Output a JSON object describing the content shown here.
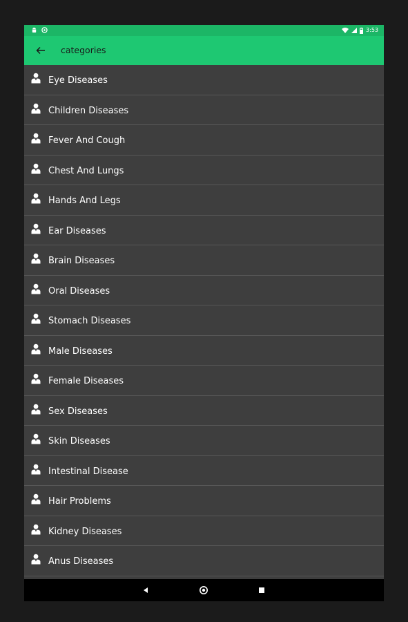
{
  "status_bar": {
    "time": "3:53",
    "background": "#1cb666"
  },
  "app_bar": {
    "title": "categories",
    "back_icon": "arrow-back-icon",
    "background": "#1ec872"
  },
  "list": {
    "item_icon": "person-icon",
    "background": "#3e3e3e",
    "items": [
      {
        "label": "Eye Diseases"
      },
      {
        "label": "Children Diseases"
      },
      {
        "label": "Fever And Cough"
      },
      {
        "label": "Chest And Lungs"
      },
      {
        "label": "Hands And Legs"
      },
      {
        "label": "Ear Diseases"
      },
      {
        "label": "Brain Diseases"
      },
      {
        "label": "Oral Diseases"
      },
      {
        "label": "Stomach Diseases"
      },
      {
        "label": "Male Diseases"
      },
      {
        "label": "Female Diseases"
      },
      {
        "label": "Sex Diseases"
      },
      {
        "label": "Skin Diseases"
      },
      {
        "label": "Intestinal Disease"
      },
      {
        "label": "Hair Problems"
      },
      {
        "label": "Kidney Diseases"
      },
      {
        "label": "Anus Diseases"
      }
    ]
  },
  "nav_bar": {
    "buttons": [
      "back-triangle-icon",
      "home-icon",
      "recents-square-icon"
    ]
  }
}
